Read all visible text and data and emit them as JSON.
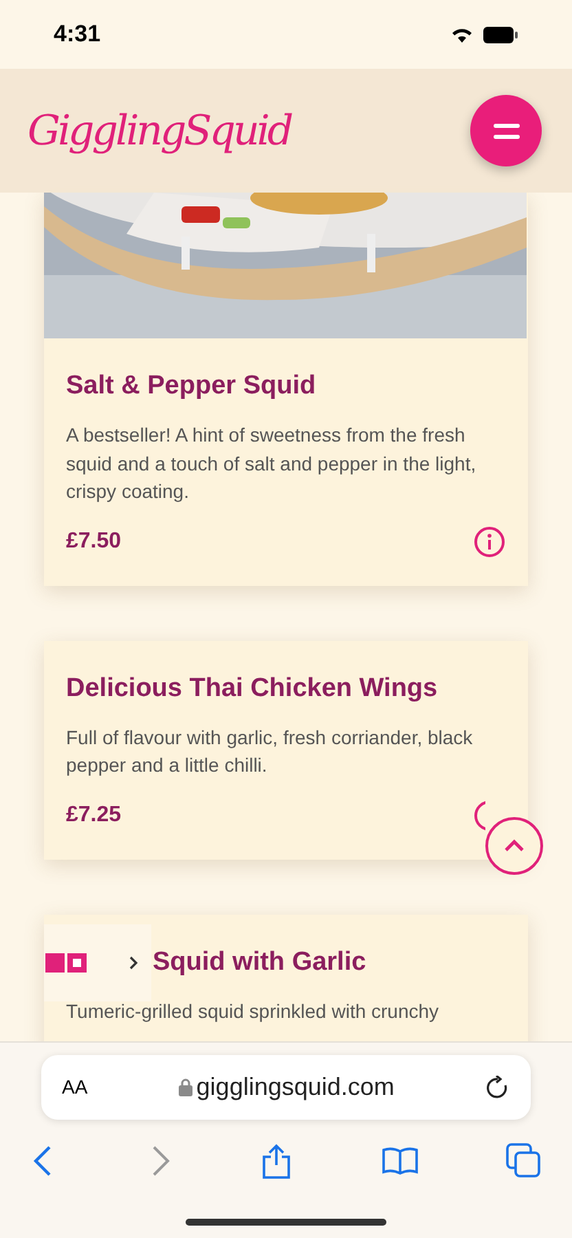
{
  "status_bar": {
    "time": "4:31"
  },
  "header": {
    "logo": "GigglingSquid"
  },
  "menu_items": [
    {
      "title": "Salt & Pepper Squid",
      "description": "A bestseller! A hint of sweetness from the fresh squid and a touch of salt and pepper in the light, crispy coating.",
      "price": "£7.50",
      "has_picture": true,
      "info_covered": false
    },
    {
      "title": "Delicious Thai Chicken Wings",
      "description": "Full of flavour with garlic, fresh corriander, black pepper and a little chilli.",
      "price": "£7.25",
      "has_picture": false,
      "info_covered": true
    },
    {
      "title": "Squid with Garlic",
      "description": "Tumeric-grilled squid sprinkled with crunchy",
      "has_picture": false
    }
  ],
  "browser": {
    "text_size": "AA",
    "url": "gigglingsquid.com",
    "back_disabled": false,
    "forward_disabled": true
  }
}
